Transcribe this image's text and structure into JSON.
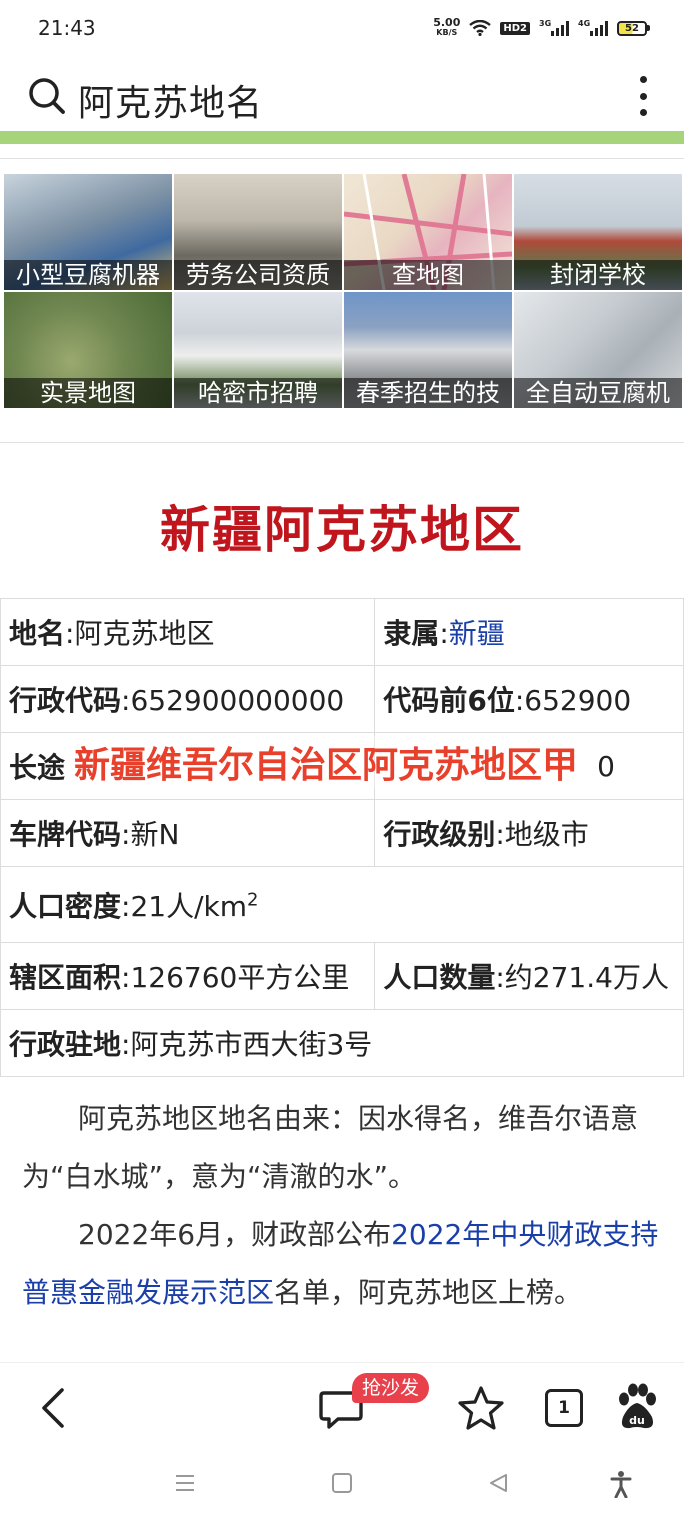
{
  "status_bar": {
    "time": "21:43",
    "net_speed_value": "5.00",
    "net_speed_unit": "KB/S",
    "hd_label": "HD2",
    "sig1_label": "3G",
    "sig2_label": "4G",
    "battery": "52"
  },
  "search": {
    "query": "阿克苏地名"
  },
  "ad_grid": {
    "items": [
      {
        "label": "小型豆腐机器",
        "bg": "#7a8fa3"
      },
      {
        "label": "劳务公司资质",
        "bg": "#8d8a80"
      },
      {
        "label": "查地图",
        "bg": "#e9d9c4"
      },
      {
        "label": "封闭学校",
        "bg": "#9aa8b8"
      },
      {
        "label": "实景地图",
        "bg": "#6f8650"
      },
      {
        "label": "哈密市招聘",
        "bg": "#b6bcc2"
      },
      {
        "label": "春季招生的技",
        "bg": "#8aa1c2"
      },
      {
        "label": "全自动豆腐机",
        "bg": "#a9b0b6"
      }
    ]
  },
  "article_title": "新疆阿克苏地区",
  "info": {
    "name_key": "地名",
    "name_val": ":阿克苏地区",
    "belongs_key": "隶属",
    "belongs_sep": ":",
    "belongs_link": "新疆",
    "code_key": "行政代码",
    "code_val": ":652900000000",
    "code6_key": "代码前6位",
    "code6_val": ":652900",
    "long_key": "长途",
    "long_val_tail": "0",
    "overlay": "新疆维吾尔自治区阿克苏地区甲",
    "plate_key": "车牌代码",
    "plate_val": ":新N",
    "level_key": "行政级别",
    "level_val": ":地级市",
    "density_key": "人口密度",
    "density_val": ":21人/km",
    "density_sup": "2",
    "area_key": "辖区面积",
    "area_val": ":126760平方公里",
    "pop_key": "人口数量",
    "pop_val": ":约271.4万人",
    "seat_key": "行政驻地",
    "seat_val": ":阿克苏市西大街3号"
  },
  "article": {
    "para1": "阿克苏地区地名由来：因水得名，维吾尔语意为“白水城”，意为“清澈的水”。",
    "para2_pre": "2022年6月，财政部公布",
    "para2_link": "2022年中央财政支持普惠金融发展示范区",
    "para2_post": "名单，阿克苏地区上榜。"
  },
  "toolbar": {
    "comment_badge": "抢沙发",
    "tab_count": "1"
  },
  "colors": {
    "headline": "#c0151c",
    "link": "#1a3fa8",
    "progress": "#a6d47a",
    "badge": "#e8414b"
  }
}
